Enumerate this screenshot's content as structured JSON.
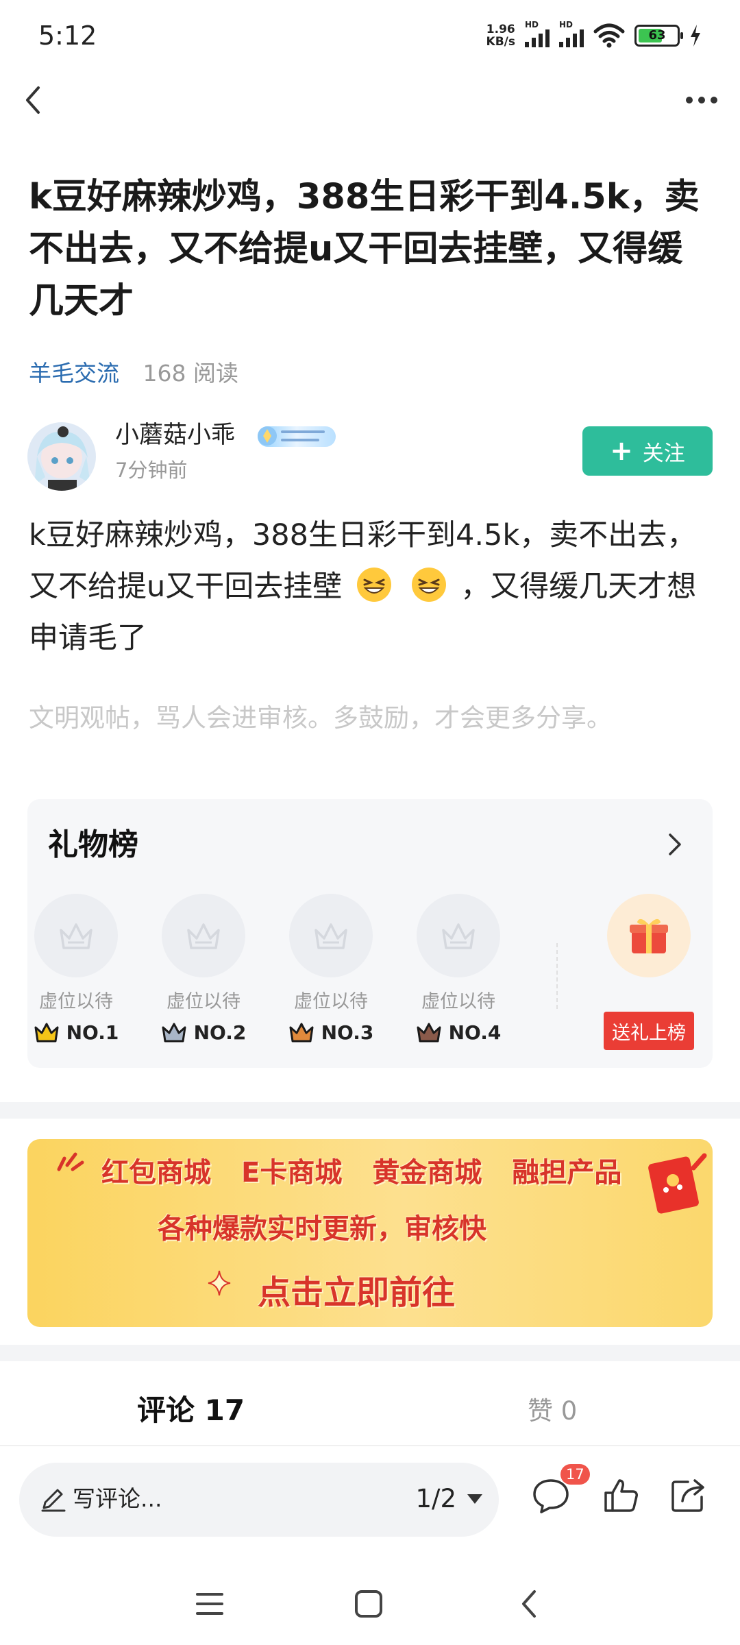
{
  "status_bar": {
    "time": "5:12",
    "net_speed_value": "1.96",
    "net_speed_unit": "KB/s",
    "signal_label_1": "HD",
    "signal_label_2": "HD",
    "battery": "63"
  },
  "post": {
    "title": "k豆好麻辣炒鸡，388生日彩干到4.5k，卖不出去，又不给提u又干回去挂壁，又得缓几天才",
    "category": "羊毛交流",
    "reads": "168 阅读",
    "body_part1": "k豆好麻辣炒鸡，388生日彩干到4.5k，卖不出去，又不给提u又干回去挂壁",
    "body_part2": "，又得缓几天才想申请毛了",
    "notice": "文明观帖，骂人会进审核。多鼓励，才会更多分享。"
  },
  "author": {
    "name": "小蘑菇小乖",
    "time": "7分钟前",
    "follow_label": "关注"
  },
  "gift_board": {
    "title": "礼物榜",
    "slots": [
      {
        "vacant": "虚位以待",
        "rank": "NO.1",
        "crown_color": "#f5c518"
      },
      {
        "vacant": "虚位以待",
        "rank": "NO.2",
        "crown_color": "#a9b6c8"
      },
      {
        "vacant": "虚位以待",
        "rank": "NO.3",
        "crown_color": "#e08a3c"
      },
      {
        "vacant": "虚位以待",
        "rank": "NO.4",
        "crown_color": "#8a5a4a"
      }
    ],
    "send_label": "送礼上榜"
  },
  "banner": {
    "items": [
      "红包商城",
      "E卡商城",
      "黄金商城",
      "融担产品"
    ],
    "subtitle": "各种爆款实时更新，审核快",
    "cta": "点击立即前往"
  },
  "tabs": {
    "comments": "评论 17",
    "likes": "赞 0"
  },
  "bottom_bar": {
    "placeholder": "写评论...",
    "page": "1/2",
    "comment_badge": "17"
  },
  "colors": {
    "accent": "#2ebd9b",
    "category": "#2b6cb0",
    "gift_red": "#ea3d35"
  }
}
